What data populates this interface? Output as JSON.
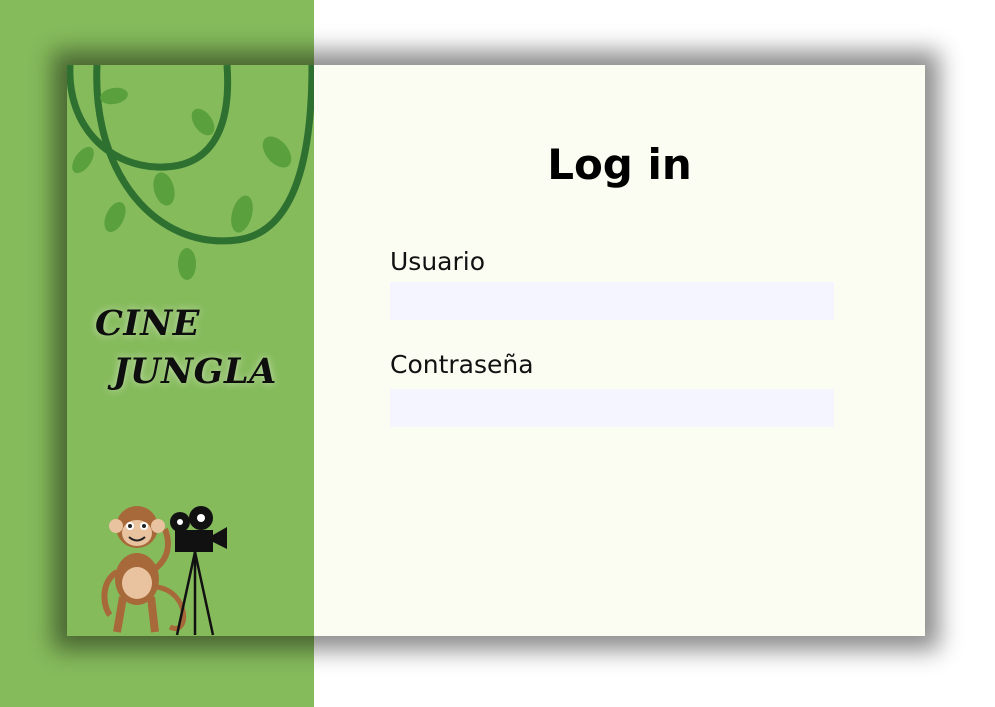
{
  "brand": {
    "line1": "CINE",
    "line2": "JUNGLA"
  },
  "login": {
    "title": "Log in",
    "username_label": "Usuario",
    "username_value": "",
    "password_label": "Contraseña",
    "password_value": ""
  },
  "colors": {
    "sidebar_green": "#86bb5c",
    "panel_background": "#fbfdf3",
    "input_background": "#f4f5fe",
    "vine_green": "#2e7030",
    "leaf_green": "#5aa03c"
  },
  "icons": [
    "jungle-vines-icon",
    "monkey-icon",
    "movie-camera-icon"
  ]
}
